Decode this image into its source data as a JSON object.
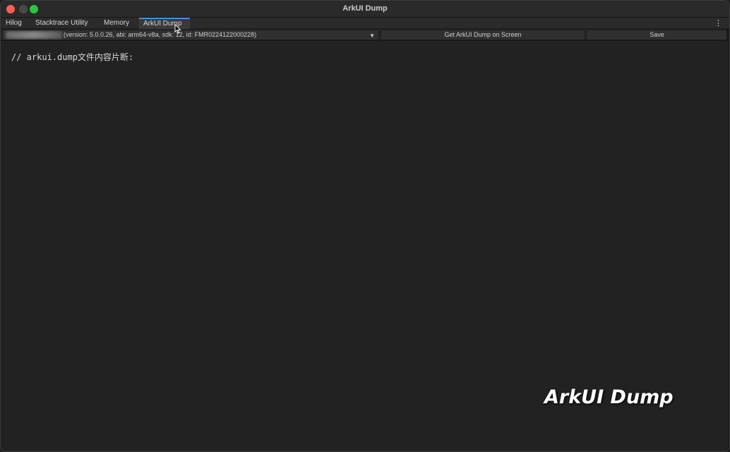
{
  "window": {
    "title": "ArkUI Dump"
  },
  "tabs": [
    {
      "label": "Hilog"
    },
    {
      "label": "Stacktrace Utility"
    },
    {
      "label": "Memory"
    },
    {
      "label": "ArkUI Dump",
      "active": true
    }
  ],
  "toolbar": {
    "device_info": "(version: 5.0.0.26, abi: arm64-v8a, sdk: 12, id: FMR0224122000228)",
    "get_dump_label": "Get ArkUI Dump on Screen",
    "save_label": "Save"
  },
  "editor": {
    "content": "// arkui.dump文件内容片断:"
  },
  "overlay": {
    "caption": "ArkUI Dump"
  },
  "icons": {
    "close": "traffic-light-close",
    "minimize": "traffic-light-minimize",
    "maximize": "traffic-light-maximize",
    "menu": "kebab-menu-icon",
    "dropdown": "chevron-down-icon",
    "cursor": "mouse-pointer-icon"
  },
  "colors": {
    "close": "#fe5f57",
    "maximize": "#28c840",
    "active_tab_accent": "#4a90d9",
    "background": "#222222"
  }
}
